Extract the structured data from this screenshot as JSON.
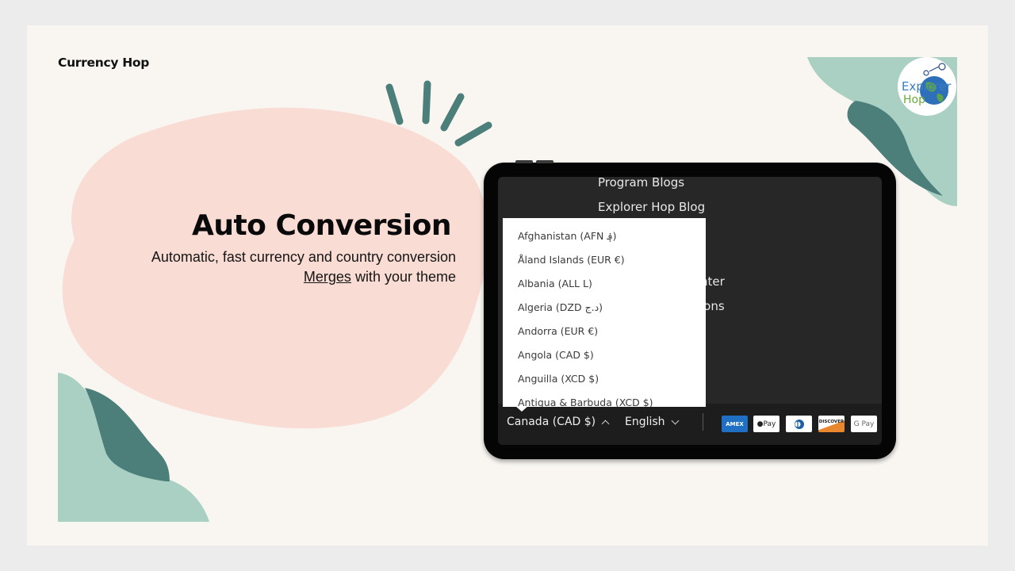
{
  "slide": {
    "brand": "Currency Hop",
    "headline": "Auto Conversion",
    "subtitle_line1": "Automatic, fast currency and country conversion",
    "subtitle_line2_link": "Merges",
    "subtitle_line2_rest": " with your theme"
  },
  "colors": {
    "background": "#f9f6f2",
    "blob_pink": "#f9dcd4",
    "teal_light": "#a9d0c3",
    "teal_dark": "#4d7f7a",
    "tablet_screen": "#272727"
  },
  "logo": {
    "line1": "Explorer",
    "line2": "Hop"
  },
  "tablet": {
    "menu_links": [
      "Program Blogs",
      "Explorer Hop Blog",
      "nter",
      "ions"
    ],
    "country_selector": "Canada (CAD $)",
    "language_selector": "English",
    "dropdown_items": [
      "Afghanistan (AFN ؋)",
      "Åland Islands (EUR €)",
      "Albania (ALL L)",
      "Algeria (DZD د.ج)",
      "Andorra (EUR €)",
      "Angola (CAD $)",
      "Anguilla (XCD $)",
      "Antigua & Barbuda (XCD $)"
    ],
    "payment_methods": [
      "AMEX",
      "Apple Pay",
      "Diners Club",
      "DISCOVER",
      "G Pay"
    ]
  }
}
